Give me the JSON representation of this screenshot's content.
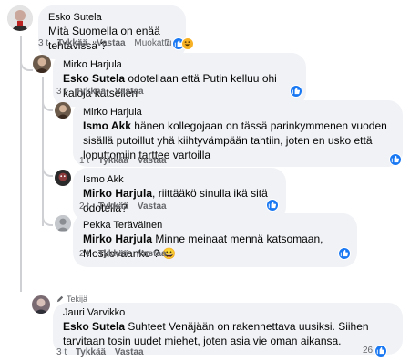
{
  "comments": [
    {
      "author": "Esko Sutela",
      "mention": "",
      "text": "Mitä Suomella on enää tehtävissä ?",
      "age": "3 t",
      "like": "Tykkää",
      "reply": "Vastaa",
      "edited": "Muokattu",
      "reactions": "7",
      "reaction_icons": [
        "like-icon",
        "haha-icon"
      ]
    },
    {
      "author": "Mirko Harjula",
      "mention": "Esko Sutela",
      "text": "odotellaan että Putin kelluu ohi kaloja katsellen",
      "age": "3 t",
      "like": "Tykkää",
      "reply": "Vastaa",
      "reactions": "",
      "reaction_icons": [
        "like-icon"
      ]
    },
    {
      "author": "Mirko Harjula",
      "mention": "Ismo Akk",
      "text": "hänen kollegojaan on tässä parinkymmenen vuoden sisällä putoillut yhä kiihtyvämpään tahtiin, joten en usko että loputtomiin tarttee vartoilla",
      "age": "1 t",
      "like": "Tykkää",
      "reply": "Vastaa",
      "reactions": "",
      "reaction_icons": [
        "like-icon"
      ]
    },
    {
      "author": "Ismo Akk",
      "mention": "Mirko Harjula",
      "text": "riittääkö sinulla ikä sitä odotella?",
      "age": "2 t",
      "like": "Tykkää",
      "reply": "Vastaa",
      "reactions": "",
      "reaction_icons": [
        "like-icon"
      ]
    },
    {
      "author": "Pekka Teräväinen",
      "mention": "Mirko Harjula",
      "text": "Minne meinaat mennä katsomaan, Moskovaanko ?",
      "emoji": "😀",
      "age": "2 t",
      "like": "Tykkää",
      "reply": "Vastaa",
      "reactions": "",
      "reaction_icons": [
        "like-icon"
      ]
    },
    {
      "badge": "Tekijä",
      "author": "Jauri Varvikko",
      "mention": "Esko Sutela",
      "text": "Suhteet Venäjään on rakennettava uusiksi. Siihen tarvitaan tosin uudet miehet, joten asia vie oman aikansa.",
      "age": "3 t",
      "like": "Tykkää",
      "reply": "Vastaa",
      "reactions": "26",
      "reaction_icons": [
        "like-icon"
      ]
    }
  ],
  "colors": {
    "like": "#1877f2",
    "haha": "#f7b125",
    "bubble": "#f0f2f5",
    "meta": "#65676b"
  }
}
